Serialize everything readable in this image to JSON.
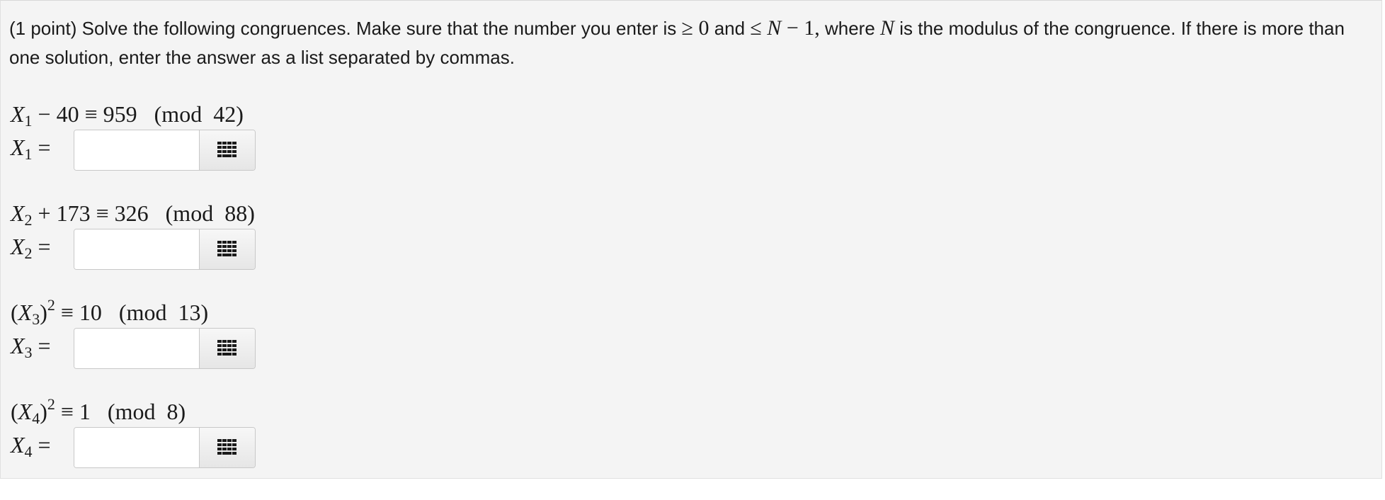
{
  "intro": {
    "t1": "(1 point) Solve the following congruences. Make sure that the number you enter is ",
    "geq": "≥ 0",
    "t2": " and ",
    "leq": "≤ ",
    "N": "N",
    "minus_one": " − 1,",
    "t3": " where ",
    "N2": "N",
    "t4": " is the modulus of the congruence. If there is more than one solution, enter the answer as a list separated by commas."
  },
  "problems": [
    {
      "eq_var": "X",
      "eq_sub": "1",
      "eq_sup": "",
      "eq_pre": "",
      "eq_post": "",
      "eq_rest": " − 40 ≡ 959   (mod  42)",
      "label_var": "X",
      "label_sub": "1",
      "label_eq": " =",
      "value": "",
      "placeholder": ""
    },
    {
      "eq_var": "X",
      "eq_sub": "2",
      "eq_sup": "",
      "eq_pre": "",
      "eq_post": "",
      "eq_rest": " + 173 ≡ 326   (mod  88)",
      "label_var": "X",
      "label_sub": "2",
      "label_eq": " =",
      "value": "",
      "placeholder": ""
    },
    {
      "eq_var": "X",
      "eq_sub": "3",
      "eq_sup": "2",
      "eq_pre": "(",
      "eq_post": ")",
      "eq_rest": " ≡ 10   (mod  13)",
      "label_var": "X",
      "label_sub": "3",
      "label_eq": " =",
      "value": "",
      "placeholder": ""
    },
    {
      "eq_var": "X",
      "eq_sub": "4",
      "eq_sup": "2",
      "eq_pre": "(",
      "eq_post": ")",
      "eq_rest": " ≡ 1   (mod  8)",
      "label_var": "X",
      "label_sub": "4",
      "label_eq": " =",
      "value": "",
      "placeholder": ""
    }
  ],
  "icons": {
    "equation_editor": "keypad-icon"
  },
  "colors": {
    "panel_bg": "#f4f4f4",
    "icon": "#1a1a1a",
    "border": "#c8c8c8"
  }
}
